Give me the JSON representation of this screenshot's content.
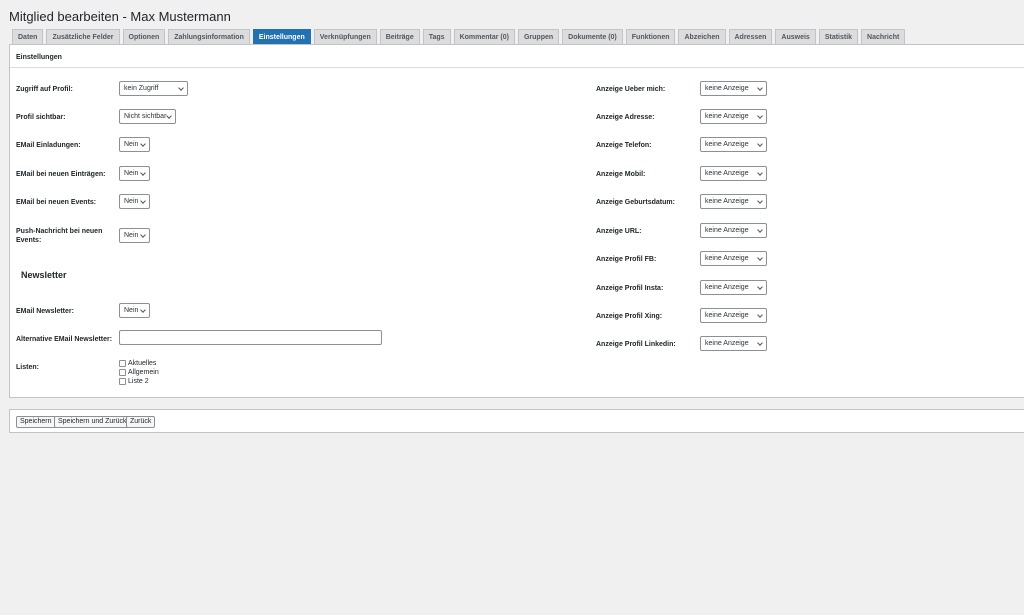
{
  "page": {
    "title": "Mitglied bearbeiten - Max Mustermann"
  },
  "tabs": [
    {
      "label": "Daten"
    },
    {
      "label": "Zusätzliche Felder"
    },
    {
      "label": "Optionen"
    },
    {
      "label": "Zahlungsinformation"
    },
    {
      "label": "Einstellungen",
      "active": true
    },
    {
      "label": "Verknüpfungen"
    },
    {
      "label": "Beiträge"
    },
    {
      "label": "Tags"
    },
    {
      "label": "Kommentar (0)"
    },
    {
      "label": "Gruppen"
    },
    {
      "label": "Dokumente (0)"
    },
    {
      "label": "Funktionen"
    },
    {
      "label": "Abzeichen"
    },
    {
      "label": "Adressen"
    },
    {
      "label": "Ausweis"
    },
    {
      "label": "Statistik"
    },
    {
      "label": "Nachricht"
    }
  ],
  "settings": {
    "heading": "Einstellungen",
    "left": [
      {
        "label": "Zugriff auf Profil:",
        "value": "kein Zugriff"
      },
      {
        "label": "Profil sichtbar:",
        "value": "Nicht sichtbar"
      },
      {
        "label": "EMail Einladungen:",
        "value": "Nein"
      },
      {
        "label": "EMail bei neuen Einträgen:",
        "value": "Nein"
      },
      {
        "label": "EMail bei neuen Events:",
        "value": "Nein"
      },
      {
        "label": "Push-Nachricht bei neuen Events:",
        "value": "Nein"
      }
    ],
    "right": [
      {
        "label": "Anzeige Ueber mich:",
        "value": "keine Anzeige"
      },
      {
        "label": "Anzeige Adresse:",
        "value": "keine Anzeige"
      },
      {
        "label": "Anzeige Telefon:",
        "value": "keine Anzeige"
      },
      {
        "label": "Anzeige Mobil:",
        "value": "keine Anzeige"
      },
      {
        "label": "Anzeige Geburtsdatum:",
        "value": "keine Anzeige"
      },
      {
        "label": "Anzeige URL:",
        "value": "keine Anzeige"
      },
      {
        "label": "Anzeige Profil FB:",
        "value": "keine Anzeige"
      },
      {
        "label": "Anzeige Profil Insta:",
        "value": "keine Anzeige"
      },
      {
        "label": "Anzeige Profil Xing:",
        "value": "keine Anzeige"
      },
      {
        "label": "Anzeige Profil Linkedin:",
        "value": "keine Anzeige"
      }
    ]
  },
  "newsletter": {
    "heading": "Newsletter",
    "email_label": "EMail Newsletter:",
    "email_value": "Nein",
    "alt_label": "Alternative EMail Newsletter:",
    "alt_value": "",
    "lists_label": "Listen:",
    "lists": [
      "Aktuelles",
      "Allgemein",
      "Liste 2"
    ]
  },
  "buttons": {
    "save": "Speichern",
    "save_back": "Speichern und Zurück",
    "back": "Zurück"
  },
  "colors": {
    "accent": "#2271b1",
    "background": "#f0f0f1"
  }
}
